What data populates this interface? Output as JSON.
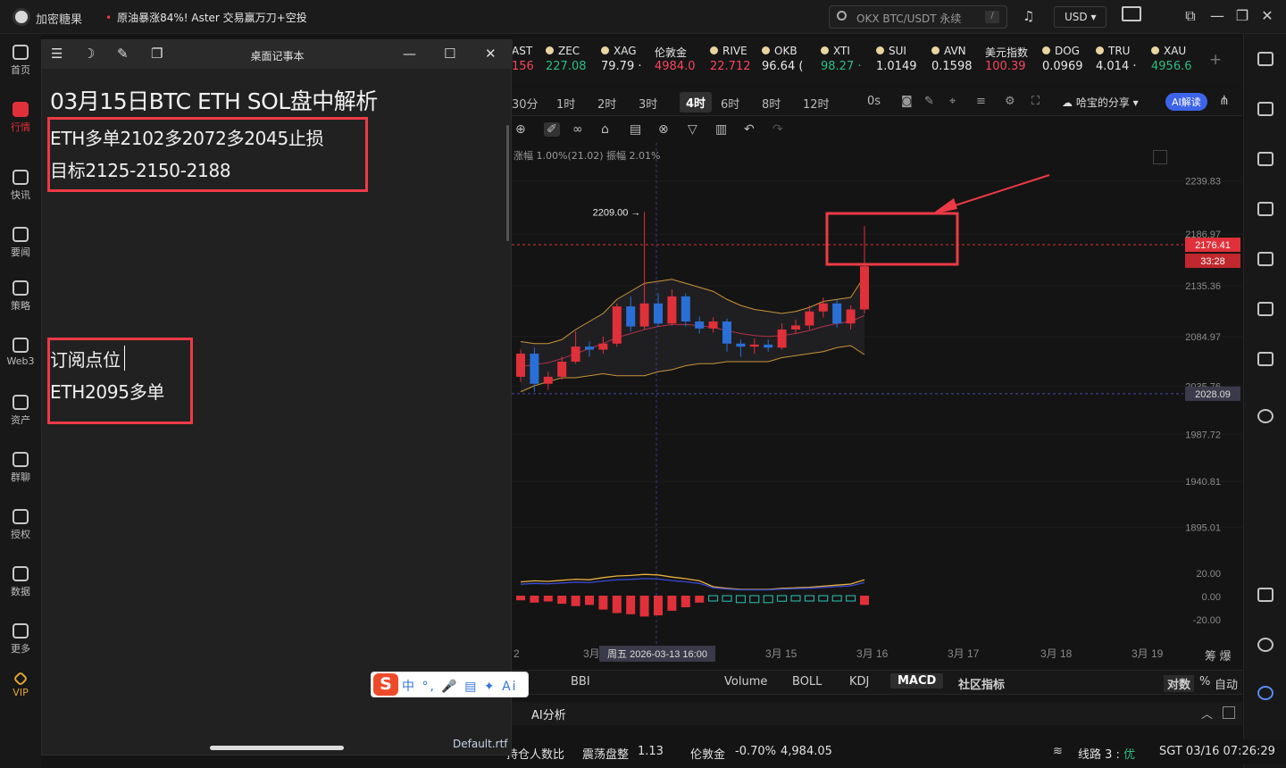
{
  "topbar": {
    "app_title": "加密糖果",
    "news": "原油暴涨84%! Aster 交易赢万刀+空投",
    "search_placeholder": "OKX BTC/USDT 永续",
    "search_slash": "/",
    "currency": "USD ▾"
  },
  "nav": [
    {
      "label": "首页",
      "icon": "home-icon"
    },
    {
      "label": "行情",
      "icon": "market-icon"
    },
    {
      "label": "快讯",
      "icon": "flash-news-icon"
    },
    {
      "label": "要闻",
      "icon": "news-icon"
    },
    {
      "label": "策略",
      "icon": "robot-icon"
    },
    {
      "label": "Web3",
      "icon": "web3-icon"
    },
    {
      "label": "资产",
      "icon": "wallet-icon"
    },
    {
      "label": "群聊",
      "icon": "chat-icon"
    },
    {
      "label": "授权",
      "icon": "auth-icon"
    },
    {
      "label": "数据",
      "icon": "data-icon"
    },
    {
      "label": "更多",
      "icon": "grid-icon"
    },
    {
      "label": "VIP",
      "icon": "vip-icon"
    }
  ],
  "notepad": {
    "title": "桌面记事本",
    "heading": "03月15日BTC ETH SOL盘中解析",
    "box1": [
      "ETH多单2102多2072多2045止损",
      "目标2125-2150-2188"
    ],
    "box2": [
      "订阅点位",
      "ETH2095多单"
    ],
    "file": "Default.rtf"
  },
  "ime": {
    "logo": "S",
    "items": "中 °, 🎤 ▤ ✦ Ai"
  },
  "tickers": [
    {
      "name": "AST",
      "price": "156",
      "cls": "dn"
    },
    {
      "name": "ZEC",
      "price": "227.08",
      "cls": "up"
    },
    {
      "name": "XAG",
      "price": "79.79 ·",
      "cls": "wt"
    },
    {
      "name": "伦敦金",
      "price": "4984.0",
      "cls": "dn"
    },
    {
      "name": "RIVE",
      "price": "22.712",
      "cls": "dn"
    },
    {
      "name": "OKB",
      "price": "96.64 (",
      "cls": "wt"
    },
    {
      "name": "XTI",
      "price": "98.27 ·",
      "cls": "up"
    },
    {
      "name": "SUI",
      "price": "1.0149",
      "cls": "wt"
    },
    {
      "name": "AVN",
      "price": "0.1598",
      "cls": "wt"
    },
    {
      "name": "美元指数",
      "price": "100.39",
      "cls": "dn"
    },
    {
      "name": "DOG",
      "price": "0.0969",
      "cls": "wt"
    },
    {
      "name": "TRU",
      "price": "4.014 ·",
      "cls": "wt"
    },
    {
      "name": "XAU",
      "price": "4956.6",
      "cls": "up"
    }
  ],
  "timeframes": [
    "30分",
    "1时",
    "2时",
    "3时",
    "4时",
    "6时",
    "8时",
    "12时",
    "0s"
  ],
  "active_tf": "4时",
  "share_label": "哈宝的分享 ▾",
  "ai_read": "AI解读",
  "chart_info": "涨幅 1.00%(21.02) 振幅 2.01%",
  "chart_data": {
    "type": "candlestick",
    "y_ticks": [
      "2239.83",
      "2186.97",
      "2135.36",
      "2084.97",
      "2035.76",
      "1987.72",
      "1940.81",
      "1895.01"
    ],
    "current_price": "2176.41",
    "countdown": "33:28",
    "crosshair_price": "2028.09",
    "high_label": "2209.00 →",
    "macd_ticks": [
      "20.00",
      "0.00",
      "-20.00"
    ],
    "x_labels": [
      "2",
      "3月",
      "3月 15",
      "3月 16",
      "3月 17",
      "3月 18",
      "3月 19"
    ],
    "crosshair_time": "周五 2026-03-13 16:00",
    "candles": [
      {
        "o": 2045,
        "c": 2068,
        "h": 2072,
        "l": 2040
      },
      {
        "o": 2068,
        "c": 2038,
        "h": 2074,
        "l": 2030
      },
      {
        "o": 2038,
        "c": 2045,
        "h": 2050,
        "l": 2032
      },
      {
        "o": 2045,
        "c": 2060,
        "h": 2065,
        "l": 2042
      },
      {
        "o": 2060,
        "c": 2075,
        "h": 2090,
        "l": 2058
      },
      {
        "o": 2075,
        "c": 2072,
        "h": 2080,
        "l": 2065
      },
      {
        "o": 2072,
        "c": 2078,
        "h": 2085,
        "l": 2068
      },
      {
        "o": 2078,
        "c": 2115,
        "h": 2118,
        "l": 2075
      },
      {
        "o": 2115,
        "c": 2095,
        "h": 2125,
        "l": 2090
      },
      {
        "o": 2095,
        "c": 2118,
        "h": 2209,
        "l": 2092
      },
      {
        "o": 2118,
        "c": 2098,
        "h": 2128,
        "l": 2095
      },
      {
        "o": 2098,
        "c": 2125,
        "h": 2132,
        "l": 2096
      },
      {
        "o": 2125,
        "c": 2100,
        "h": 2128,
        "l": 2095
      },
      {
        "o": 2100,
        "c": 2093,
        "h": 2105,
        "l": 2088
      },
      {
        "o": 2093,
        "c": 2100,
        "h": 2104,
        "l": 2089
      },
      {
        "o": 2100,
        "c": 2078,
        "h": 2103,
        "l": 2070
      },
      {
        "o": 2078,
        "c": 2075,
        "h": 2082,
        "l": 2065
      },
      {
        "o": 2075,
        "c": 2077,
        "h": 2083,
        "l": 2068
      },
      {
        "o": 2077,
        "c": 2074,
        "h": 2082,
        "l": 2070
      },
      {
        "o": 2074,
        "c": 2092,
        "h": 2098,
        "l": 2072
      },
      {
        "o": 2092,
        "c": 2096,
        "h": 2102,
        "l": 2088
      },
      {
        "o": 2096,
        "c": 2110,
        "h": 2116,
        "l": 2092
      },
      {
        "o": 2110,
        "c": 2118,
        "h": 2124,
        "l": 2104
      },
      {
        "o": 2118,
        "c": 2098,
        "h": 2122,
        "l": 2094
      },
      {
        "o": 2098,
        "c": 2112,
        "h": 2116,
        "l": 2092
      },
      {
        "o": 2112,
        "c": 2155,
        "h": 2195,
        "l": 2108
      }
    ],
    "macd": [
      -4,
      -6,
      -5,
      -7,
      -9,
      -8,
      -12,
      -15,
      -16,
      -18,
      -17,
      -13,
      -10,
      -6,
      5,
      8,
      10,
      10,
      10,
      8,
      7,
      6,
      4,
      2,
      0,
      -8
    ],
    "bands": {
      "mid": [
        2055,
        2057,
        2059,
        2063,
        2068,
        2073,
        2078,
        2084,
        2088,
        2092,
        2095,
        2097,
        2097,
        2096,
        2094,
        2091,
        2088,
        2086,
        2085,
        2086,
        2088,
        2091,
        2095,
        2098,
        2100,
        2106
      ],
      "upper": [
        2080,
        2078,
        2078,
        2082,
        2092,
        2100,
        2108,
        2122,
        2130,
        2138,
        2140,
        2142,
        2138,
        2134,
        2130,
        2122,
        2116,
        2112,
        2110,
        2108,
        2110,
        2114,
        2120,
        2122,
        2124,
        2145
      ],
      "lower": [
        2030,
        2036,
        2040,
        2044,
        2044,
        2046,
        2048,
        2046,
        2046,
        2046,
        2050,
        2052,
        2056,
        2058,
        2058,
        2060,
        2060,
        2060,
        2060,
        2064,
        2066,
        2068,
        2070,
        2074,
        2076,
        2067
      ]
    },
    "ymin": 1860,
    "ymax": 2260
  },
  "indicators": [
    "BBI",
    "Volume",
    "BOLL",
    "KDJ",
    "MACD",
    "社区指标"
  ],
  "active_indicator": "MACD",
  "indicator_right": [
    "对数",
    "%",
    "自动"
  ],
  "ai_analysis": "AI分析",
  "status": {
    "holders": "持仓人数比",
    "regime": "震荡盘整",
    "ratio": "1.13",
    "gold_name": "伦敦金",
    "gold_change": "-0.70%",
    "gold_price": "4,984.05",
    "route": "线路 3 :",
    "route_quality": "优",
    "clock": "SGT 03/16 07:26:29"
  }
}
